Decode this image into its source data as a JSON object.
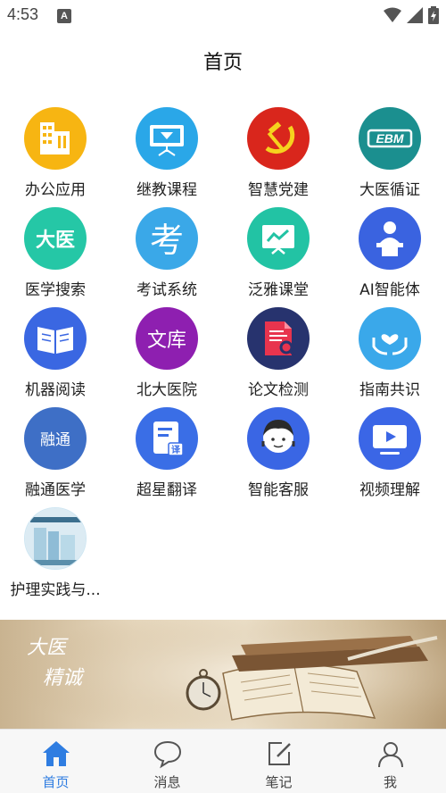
{
  "status_bar": {
    "time": "4:53",
    "notification_letter": "A"
  },
  "header": {
    "title": "首页"
  },
  "apps": [
    {
      "label": "办公应用",
      "icon": "office-buildings-icon",
      "color": "#f7b512"
    },
    {
      "label": "继教课程",
      "icon": "presentation-board-icon",
      "color": "#2aa7e8"
    },
    {
      "label": "智慧党建",
      "icon": "hammer-sickle-icon",
      "color": "#d9261c"
    },
    {
      "label": "大医循证",
      "icon": "ebm-logo-icon",
      "color": "#1b8f8f",
      "text": "EBM"
    },
    {
      "label": "医学搜索",
      "icon": "dayi-text-icon",
      "color": "#25c7a6",
      "text": "大医"
    },
    {
      "label": "考试系统",
      "icon": "exam-character-icon",
      "color": "#3aa8e8",
      "text": "考"
    },
    {
      "label": "泛雅课堂",
      "icon": "classroom-chart-icon",
      "color": "#22c3a4"
    },
    {
      "label": "AI智能体",
      "icon": "speaker-podium-icon",
      "color": "#3a63e0"
    },
    {
      "label": "机器阅读",
      "icon": "open-book-icon",
      "color": "#3a67e2"
    },
    {
      "label": "北大医院",
      "icon": "wenku-text-icon",
      "color": "#8e1fb0",
      "text": "文库"
    },
    {
      "label": "论文检测",
      "icon": "document-search-icon",
      "color": "#27336e"
    },
    {
      "label": "指南共识",
      "icon": "hands-heart-icon",
      "color": "#3aa8ea"
    },
    {
      "label": "融通医学",
      "icon": "rongtong-text-icon",
      "color": "#3e6fc6",
      "text": "融通"
    },
    {
      "label": "超星翻译",
      "icon": "translate-doc-icon",
      "color": "#3a6ee6",
      "text": "译"
    },
    {
      "label": "智能客服",
      "icon": "customer-service-icon",
      "color": "#3a66e4"
    },
    {
      "label": "视频理解",
      "icon": "video-play-icon",
      "color": "#3b66e6"
    },
    {
      "label": "护理实践与...",
      "icon": "nursing-book-cover-icon",
      "color": "#cfe6f2"
    }
  ],
  "banner": {
    "line1": "大医",
    "line2": "精诚"
  },
  "tabbar": {
    "items": [
      {
        "label": "首页",
        "icon": "home-icon",
        "active": true
      },
      {
        "label": "消息",
        "icon": "chat-bubble-icon",
        "active": false
      },
      {
        "label": "笔记",
        "icon": "edit-note-icon",
        "active": false
      },
      {
        "label": "我",
        "icon": "person-icon",
        "active": false
      }
    ],
    "active_color": "#2f7de1",
    "inactive_color": "#444444"
  }
}
